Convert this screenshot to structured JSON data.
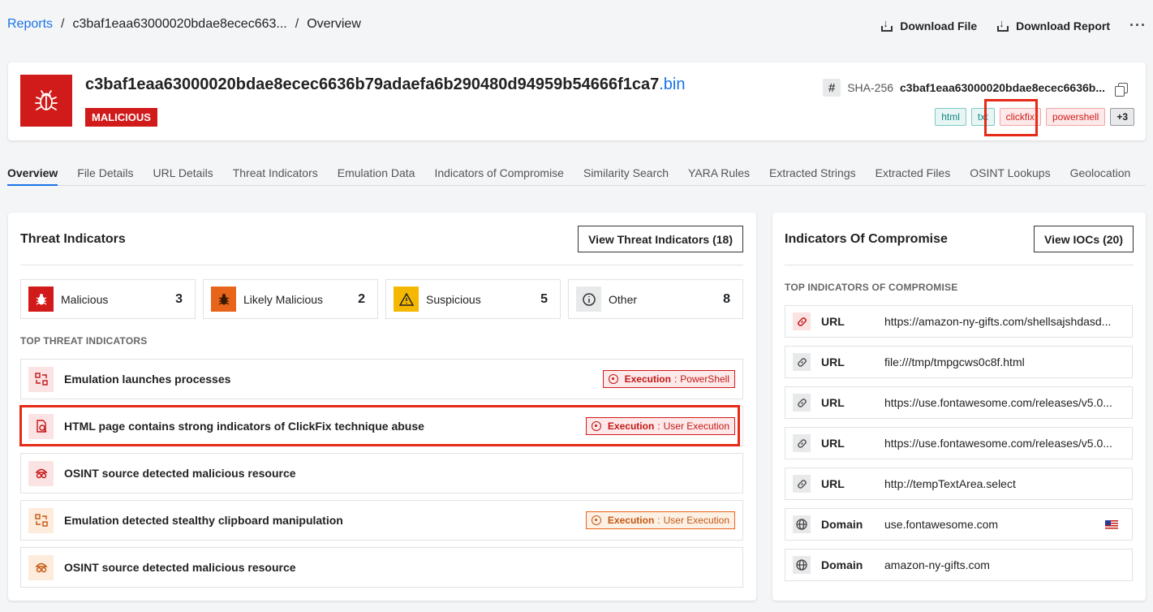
{
  "breadcrumb": {
    "root": "Reports",
    "hash": "c3baf1eaa63000020bdae8ecec663...",
    "current": "Overview"
  },
  "top_actions": {
    "download_file": "Download File",
    "download_report": "Download Report",
    "more": "···"
  },
  "file": {
    "hash_name": "c3baf1eaa63000020bdae8ecec6636b79adaefa6b290480d94959b54666f1ca7",
    "extension": ".bin",
    "verdict": "MALICIOUS",
    "sha_label": "SHA-256",
    "sha_value": "c3baf1eaa63000020bdae8ecec6636b...",
    "hash_symbol": "#",
    "tags": [
      "html",
      "txt",
      "clickfix",
      "powershell"
    ],
    "more_tags": "+3"
  },
  "tabs": [
    "Overview",
    "File Details",
    "URL Details",
    "Threat Indicators",
    "Emulation Data",
    "Indicators of Compromise",
    "Similarity Search",
    "YARA Rules",
    "Extracted Strings",
    "Extracted Files",
    "OSINT Lookups",
    "Geolocation"
  ],
  "threat_indicators": {
    "title": "Threat Indicators",
    "view_button": "View Threat Indicators (18)",
    "counts": [
      {
        "label": "Malicious",
        "count": "3",
        "color": "#d11a1a"
      },
      {
        "label": "Likely Malicious",
        "count": "2",
        "color": "#e8641a"
      },
      {
        "label": "Suspicious",
        "count": "5",
        "color": "#f5b800"
      },
      {
        "label": "Other",
        "count": "8",
        "color": "#e8e9eb"
      }
    ],
    "section_label": "TOP THREAT INDICATORS",
    "items": [
      {
        "text": "Emulation launches processes",
        "tactic": "Execution",
        "technique": "PowerShell"
      },
      {
        "text": "HTML page contains strong indicators of ClickFix technique abuse",
        "tactic": "Execution",
        "technique": "User Execution"
      },
      {
        "text": "OSINT source detected malicious resource"
      },
      {
        "text": "Emulation detected stealthy clipboard manipulation",
        "tactic": "Execution",
        "technique": "User Execution"
      },
      {
        "text": "OSINT source detected malicious resource"
      }
    ]
  },
  "iocs": {
    "title": "Indicators Of Compromise",
    "view_button": "View IOCs (20)",
    "section_label": "TOP INDICATORS OF COMPROMISE",
    "items": [
      {
        "type": "URL",
        "value": "https://amazon-ny-gifts.com/shellsajshdasd..."
      },
      {
        "type": "URL",
        "value": "file:///tmp/tmpgcws0c8f.html"
      },
      {
        "type": "URL",
        "value": "https://use.fontawesome.com/releases/v5.0..."
      },
      {
        "type": "URL",
        "value": "https://use.fontawesome.com/releases/v5.0..."
      },
      {
        "type": "URL",
        "value": "http://tempTextArea.select"
      },
      {
        "type": "Domain",
        "value": "use.fontawesome.com"
      },
      {
        "type": "Domain",
        "value": "amazon-ny-gifts.com"
      }
    ]
  }
}
